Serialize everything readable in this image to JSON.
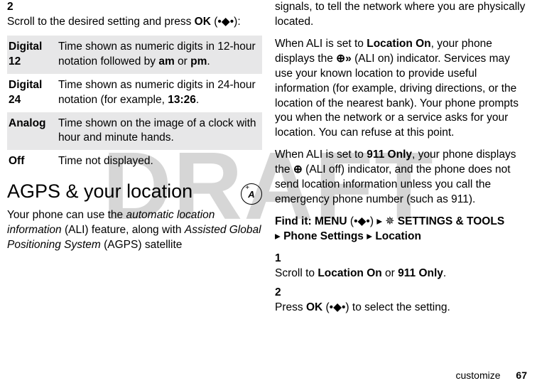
{
  "watermark": "DRAFT",
  "left": {
    "step2": {
      "num": "2",
      "text_a": "Scroll to the desired setting and press ",
      "ok": "OK",
      "keyglyph": "(•◆•)",
      "text_b": ":"
    },
    "opts": [
      {
        "k": "Digital 12",
        "v_a": "Time shown as numeric digits in 12-hour notation followed by ",
        "am": "am",
        "v_b": " or ",
        "pm": "pm",
        "v_c": "."
      },
      {
        "k": "Digital 24",
        "v_a": "Time shown as numeric digits in 24-hour notation (for example, ",
        "ex": "13:26",
        "v_b": "."
      },
      {
        "k": "Analog",
        "v": "Time shown on the image of a clock with hour and minute hands."
      },
      {
        "k": "Off",
        "v": "Time not displayed."
      }
    ],
    "heading": "AGPS & your location",
    "badge": "A",
    "intro_a": "Your phone can use the ",
    "intro_i1": "automatic location information",
    "intro_b": " (ALI) feature, along with ",
    "intro_i2": "Assisted Global Positioning System",
    "intro_c": " (AGPS) satellite"
  },
  "right": {
    "p1": "signals, to tell the network where you are physically located.",
    "p2_a": "When ALI is set to ",
    "p2_loc": "Location On",
    "p2_b": ", your phone displays the ",
    "p2_glyph": "⊕»",
    "p2_c": " (ALI on) indicator. Services may use your known location to provide useful information (for example, driving directions, or the location of the nearest bank). Your phone prompts you when the network or a service asks for your location. You can refuse at this point.",
    "p3_a": "When ALI is set to ",
    "p3_only": "911 Only",
    "p3_b": ", your phone displays the ",
    "p3_glyph": "⊕",
    "p3_c": " (ALI off) indicator, and the phone does not send location information unless you call the emergency phone number (such as 911).",
    "findit": "Find it: ",
    "menu": "MENU",
    "keyglyph": "(•◆•)",
    "arrow1": "▸",
    "gear": "✵",
    "settings": "SETTINGS & TOOLS",
    "arrow2": "▸",
    "phone": "Phone Settings",
    "arrow3": "▸",
    "loc": "Location",
    "s1": {
      "num": "1",
      "a": "Scroll to ",
      "lo": "Location On",
      "b": " or ",
      "n": "911 Only",
      "c": "."
    },
    "s2": {
      "num": "2",
      "a": "Press ",
      "ok": "OK",
      "g": "(•◆•)",
      "b": " to select the setting."
    }
  },
  "footer": {
    "label": "customize",
    "page": "67"
  }
}
